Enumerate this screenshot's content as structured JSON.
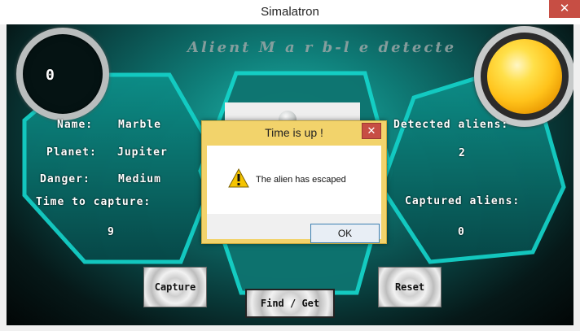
{
  "window": {
    "title": "Simalatron",
    "close_glyph": "✕"
  },
  "banner": {
    "text": "Alient M a r b-l e detecte"
  },
  "timer_display": "0",
  "left_panel": {
    "name_label": "Name:",
    "name_value": "Marble",
    "planet_label": "Planet:",
    "planet_value": "Jupiter",
    "danger_label": "Danger:",
    "danger_value": "Medium",
    "time_label": "Time to capture:",
    "time_value": "9"
  },
  "right_panel": {
    "detected_label": "Detected aliens:",
    "detected_value": "2",
    "captured_label": "Captured aliens:",
    "captured_value": "0"
  },
  "buttons": {
    "capture": "Capture",
    "find_get": "Find / Get",
    "reset": "Reset"
  },
  "dialog": {
    "title": "Time is up !",
    "close_glyph": "✕",
    "message": "The alien has escaped",
    "ok": "OK",
    "icon": "warning-icon"
  },
  "colors": {
    "accent": "#1fb7ad",
    "dialog_title": "#f2d36b",
    "close_red": "#c74e44",
    "orb": "#ffc21a"
  }
}
